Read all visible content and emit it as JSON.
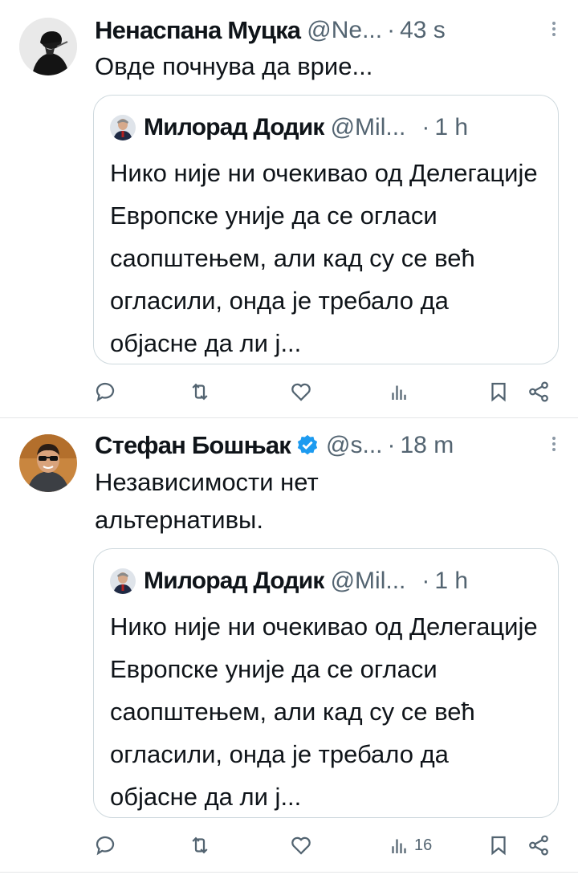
{
  "tweets": [
    {
      "author": {
        "name": "Ненаспана Муцка",
        "handle": "@Ne...",
        "verified": false
      },
      "time": "43 s",
      "separator": "·",
      "text": "Овде почнува да врие...",
      "quote": {
        "author": {
          "name": "Милорад Додик",
          "handle": "@Mil..."
        },
        "time": "1 h",
        "separator": "·",
        "text": "Нико није ни очекивао од Делегације Европске уније да се огласи саопштењем, али кад су се већ огласили, онда је требало да објасне да ли ј..."
      },
      "actions": {
        "reply": "",
        "retweet": "",
        "like": "",
        "views": "",
        "bookmark": "",
        "share": ""
      }
    },
    {
      "author": {
        "name": "Стефан Бошњак",
        "handle": "@s...",
        "verified": true
      },
      "time": "18 m",
      "separator": "·",
      "text_lines": [
        "Независимости нет",
        "альтернативы."
      ],
      "quote": {
        "author": {
          "name": "Милорад Додик",
          "handle": "@Mil..."
        },
        "time": "1 h",
        "separator": "·",
        "text": "Нико није ни очекивао од Делегације Европске уније да се огласи саопштењем, али кад су се већ огласили, онда је требало да објасне да ли ј..."
      },
      "actions": {
        "reply": "",
        "retweet": "",
        "like": "",
        "views": "16",
        "bookmark": "",
        "share": ""
      }
    }
  ],
  "icons": {
    "reply": "speech-bubble",
    "retweet": "two-arrows-loop",
    "like": "heart-outline",
    "views": "bar-chart",
    "bookmark": "bookmark-outline",
    "share": "share-nodes",
    "more": "vertical-ellipsis",
    "verified": "blue-check-badge"
  },
  "colors": {
    "text": "#0f1419",
    "secondary": "#536471",
    "border": "#cfd9de",
    "verified": "#1d9bf0"
  }
}
